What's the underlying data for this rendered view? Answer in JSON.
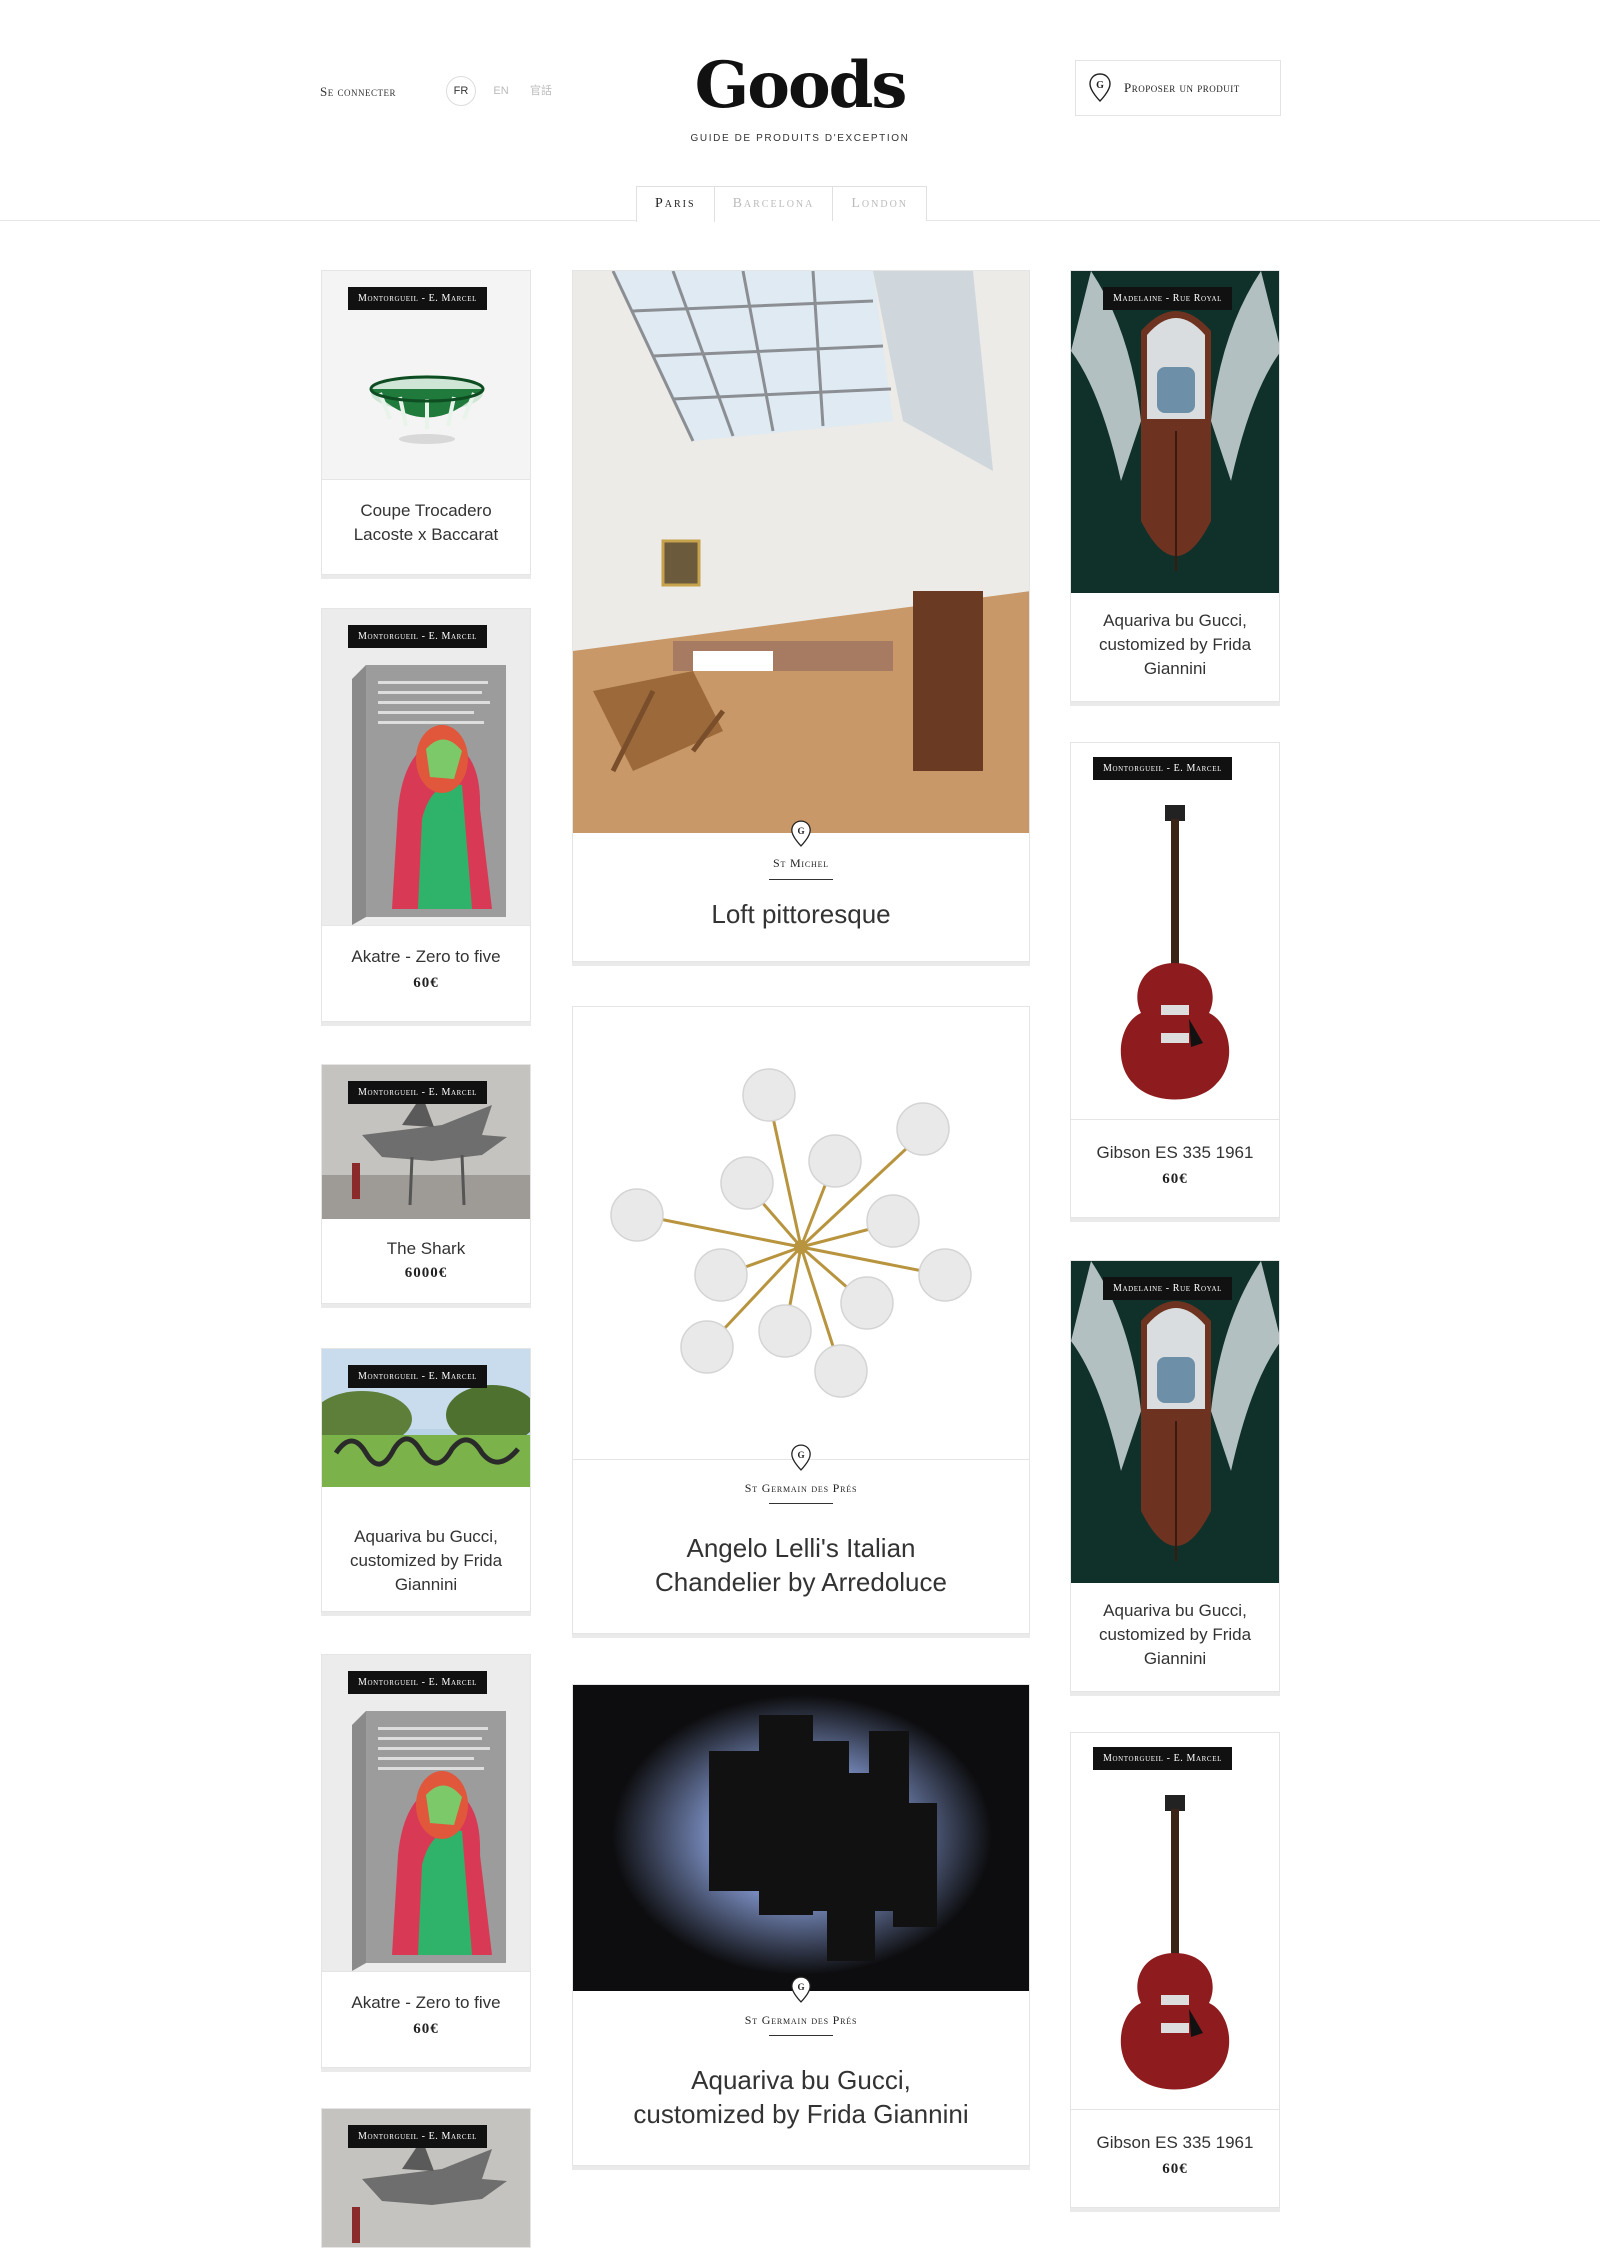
{
  "header": {
    "login": "Se connecter",
    "languages": [
      "FR",
      "EN",
      "官話"
    ],
    "logo": "Goods",
    "tagline": "GUIDE DE PRODUITS D'EXCEPTION",
    "propose": "Proposer un produit"
  },
  "tabs": [
    "Paris",
    "Barcelona",
    "London"
  ],
  "left": [
    {
      "badge": "Montorgueil - E. Marcel",
      "title": "Coupe Trocadero\nLacoste x Baccarat",
      "price": ""
    },
    {
      "badge": "Montorgueil - E. Marcel",
      "title": "Akatre - Zero to five",
      "price": "60€"
    },
    {
      "badge": "Montorgueil - E. Marcel",
      "title": "The Shark",
      "price": "6000€"
    },
    {
      "badge": "Montorgueil - E. Marcel",
      "title": "Aquariva bu Gucci,\ncustomized by Frida\nGiannini",
      "price": ""
    },
    {
      "badge": "Montorgueil - E. Marcel",
      "title": "Akatre - Zero to five",
      "price": "60€"
    },
    {
      "badge": "Montorgueil - E. Marcel",
      "title": "",
      "price": ""
    }
  ],
  "center": [
    {
      "location": "St Michel",
      "title": "Loft pittoresque"
    },
    {
      "location": "St Germain des Prés",
      "title": "Angelo Lelli's Italian\nChandelier by Arredoluce"
    },
    {
      "location": "St Germain des Prés",
      "title": "Aquariva bu Gucci,\ncustomized by Frida Giannini"
    }
  ],
  "right": [
    {
      "badge": "Madelaine - Rue Royal",
      "title": "Aquariva bu Gucci,\ncustomized by Frida\nGiannini",
      "price": ""
    },
    {
      "badge": "Montorgueil - E. Marcel",
      "title": "Gibson ES 335 1961",
      "price": "60€"
    },
    {
      "badge": "Madelaine - Rue Royal",
      "title": "Aquariva bu Gucci,\ncustomized by Frida\nGiannini",
      "price": ""
    },
    {
      "badge": "Montorgueil - E. Marcel",
      "title": "Gibson ES 335 1961",
      "price": "60€"
    }
  ],
  "icons": {
    "pin": "location-pin-icon",
    "propose": "location-pin-icon"
  }
}
